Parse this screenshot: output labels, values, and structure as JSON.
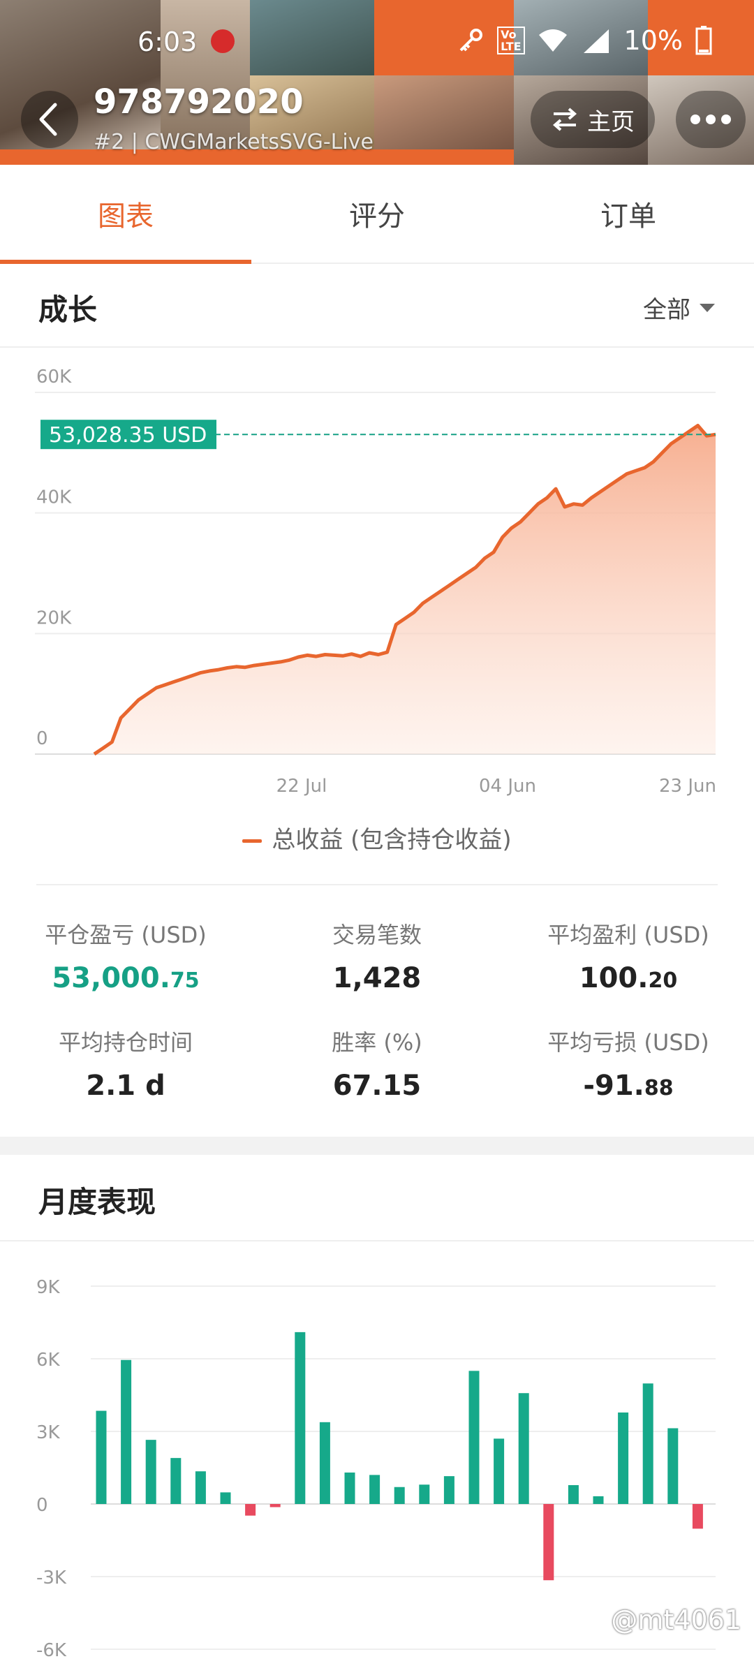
{
  "status_bar": {
    "time": "6:03",
    "battery": "10%",
    "network": "4G"
  },
  "account": {
    "title": "978792020",
    "subtitle": "#2 | CWGMarketsSVG-Live"
  },
  "header_buttons": {
    "home_label": "主页"
  },
  "tabs": [
    {
      "label": "图表",
      "active": true
    },
    {
      "label": "评分",
      "active": false
    },
    {
      "label": "订单",
      "active": false
    }
  ],
  "growth": {
    "title": "成长",
    "filter": "全部",
    "current_label": "53,028.35 USD"
  },
  "legend": {
    "label": "总收益 (包含持仓收益)"
  },
  "stats": {
    "closed_pl": {
      "label": "平仓盈亏 (USD)",
      "int": "53,000.",
      "dec": "75",
      "color": "#16a085"
    },
    "trades": {
      "label": "交易笔数",
      "value": "1,428"
    },
    "avg_profit": {
      "label": "平均盈利 (USD)",
      "int": "100.",
      "dec": "20"
    },
    "avg_hold": {
      "label": "平均持仓时间",
      "value": "2.1 d"
    },
    "win_rate": {
      "label": "胜率 (%)",
      "value": "67.15"
    },
    "avg_loss": {
      "label": "平均亏损 (USD)",
      "int": "-91.",
      "dec": "88"
    }
  },
  "monthly": {
    "title": "月度表现"
  },
  "watermark": "@mt4061",
  "colors": {
    "accent": "#e8662e",
    "positive": "#16a98a",
    "negative": "#e84a5f"
  },
  "chart_data": [
    {
      "type": "area",
      "ylim": [
        0,
        60000
      ],
      "y_ticks": [
        "60K",
        "40K",
        "20K",
        "0"
      ],
      "x_ticks": [
        "22 Jul",
        "04 Jun",
        "23 Jun"
      ],
      "series": [
        {
          "name": "总收益 (包含持仓收益)",
          "values": [
            0,
            1000,
            2000,
            6000,
            7500,
            9000,
            10000,
            11000,
            11500,
            12000,
            12500,
            13000,
            13500,
            13800,
            14000,
            14300,
            14500,
            14400,
            14700,
            14900,
            15100,
            15300,
            15600,
            16100,
            16400,
            16200,
            16500,
            16400,
            16300,
            16600,
            16200,
            16800,
            16500,
            16900,
            21500,
            22500,
            23500,
            25000,
            26000,
            27000,
            28000,
            29000,
            30000,
            31000,
            32500,
            33500,
            36000,
            37500,
            38500,
            40000,
            41500,
            42500,
            44000,
            41000,
            41500,
            41300,
            42500,
            43500,
            44500,
            45500,
            46500,
            47000,
            47500,
            48500,
            50000,
            51500,
            52500,
            53500,
            54500,
            52800,
            53028
          ]
        }
      ]
    },
    {
      "type": "bar",
      "ylim": [
        -6000,
        9000
      ],
      "y_ticks": [
        "9K",
        "6K",
        "3K",
        "0",
        "-3K",
        "-6K"
      ],
      "values": [
        3850,
        5950,
        2650,
        1900,
        1350,
        480,
        -480,
        -130,
        7100,
        3380,
        1300,
        1200,
        700,
        800,
        1150,
        5500,
        2700,
        4580,
        -3150,
        780,
        320,
        3780,
        4980,
        3130,
        -1020
      ]
    }
  ]
}
